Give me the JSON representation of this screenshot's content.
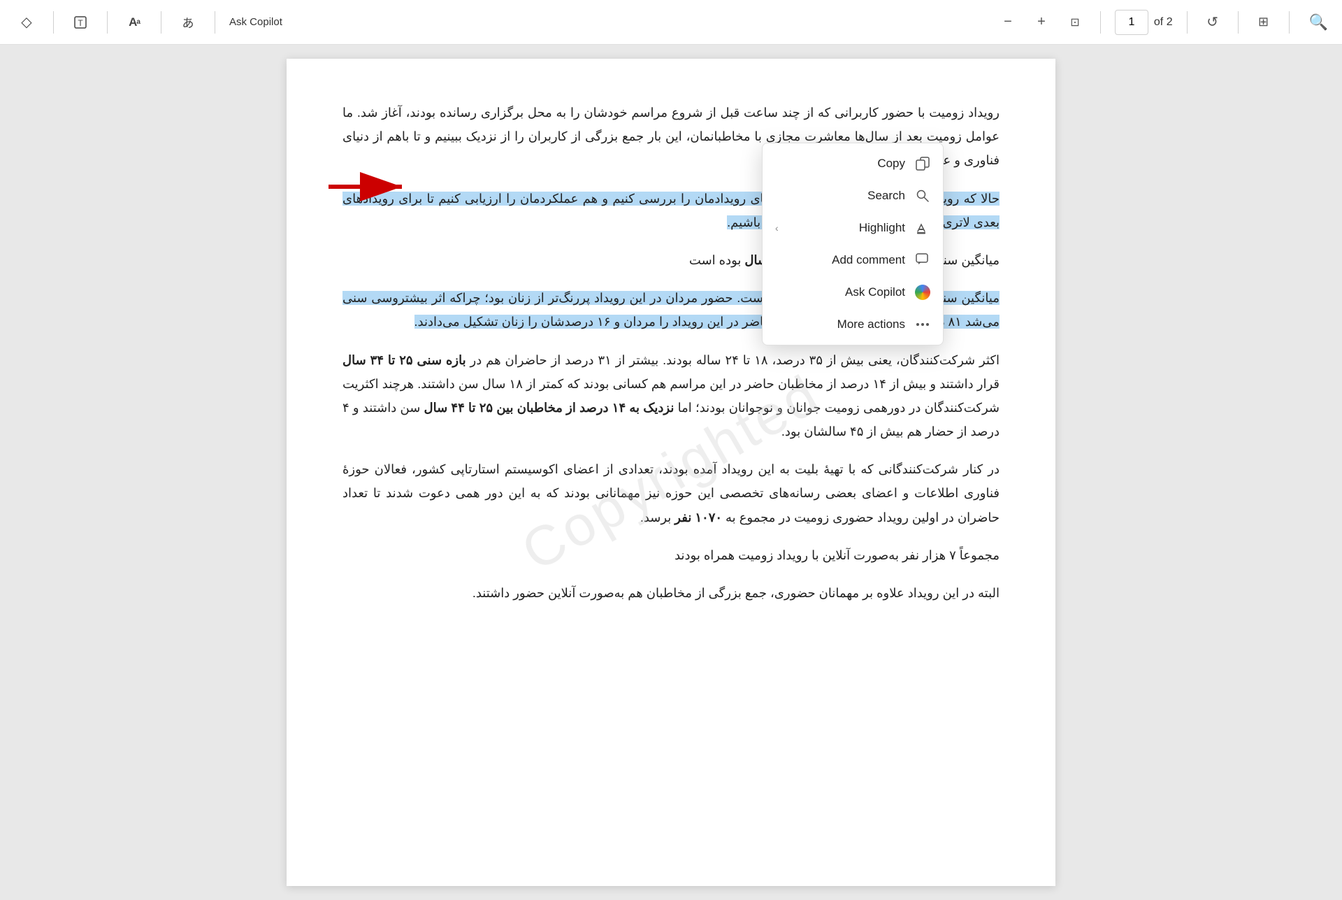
{
  "toolbar": {
    "tools": [
      {
        "id": "eraser",
        "icon": "◇",
        "label": "Eraser tool"
      },
      {
        "id": "text",
        "icon": "⊤",
        "label": "Text tool"
      },
      {
        "id": "font",
        "icon": "Aᵃ",
        "label": "Font"
      },
      {
        "id": "lang",
        "icon": "あ",
        "label": "Language"
      },
      {
        "id": "copilot",
        "icon": "Ask Copilot",
        "label": "Ask Copilot"
      }
    ],
    "zoom_minus": "−",
    "zoom_plus": "+",
    "zoom_fit": "⊡",
    "page_current": "1",
    "page_of": "of 2",
    "rotate": "↺",
    "layout": "⊞",
    "search_icon": "🔍"
  },
  "context_menu": {
    "items": [
      {
        "id": "copy",
        "icon": "copy",
        "label": "Copy",
        "arrow": false
      },
      {
        "id": "search",
        "icon": "search",
        "label": "Search",
        "arrow": false
      },
      {
        "id": "highlight",
        "icon": "highlight",
        "label": "Highlight",
        "arrow": true
      },
      {
        "id": "add-comment",
        "icon": "comment",
        "label": "Add comment",
        "arrow": false
      },
      {
        "id": "ask-copilot",
        "icon": "copilot",
        "label": "Ask Copilot",
        "arrow": false
      },
      {
        "id": "more-actions",
        "icon": "more",
        "label": "More actions",
        "arrow": false
      }
    ]
  },
  "document": {
    "paragraphs": [
      {
        "id": "p1",
        "text": "رویداد زومیت با حضور کاربرانی که از چند ساعت قبل از شروع مراسم خودشان را به محل برگزاری رسانده بودند، آغاز شد. ما عوامل زومیت بعد از سال‌ها معاشرت مجازی با مخاطبانمان، این بار جمع بزرگی از کاربران را از نزدیک ببینیم و تا باهم از دنیای فناوری و علایقمان بگوییم.",
        "highlighted": false
      },
      {
        "id": "p2",
        "text": "حالا که رویداد برگزار شده است که هم آمارهای رویدادمان را بررسی کنیم و هم عملکردمان را ارزیابی کنیم تا برای رویدادهای بعدی لاتری به دیدار شما بیاییم و میزبان بهتری باشیم.",
        "highlighted": true
      },
      {
        "id": "p3",
        "text": "میانگین سنی حاضران در رویداد زومیت ۲۶.۱ سال بوده است",
        "highlighted": false
      },
      {
        "id": "p4",
        "text": "میانگین سنی جمعیت زومیت ۲۶.۱ سال بوده است. حضور مردان در این رویداد پررنگ‌تر از زنان بود؛ چراکه اثر بیشتروسی سن می‌شد ۸۱ درصد از جمعیت بیش از هزار نفر حاضر در این رویداد را مردان و ۱۶ درصدشان را زنان تشکیل می‌دادند.",
        "highlighted": true
      },
      {
        "id": "p5",
        "text": "اکثر شرکت‌کنندگان، یعنی بیش از ۳۵ درصد، ۱۸ تا ۲۴ ساله بودند. بیشتر از ۳۱ درصد از حاضران هم در بازه سنی ۲۵ تا ۳۴ سال قرار داشتند و بیش از ۱۴ درصد از مخاطبان حاضر در این مراسم هم کسانی بودند که کمتر از ۱۸ سال سن داشتند. هرچند اکثریت شرکت‌کنندگان در دورهمی زومیت جوانان و نوجوانان بودند؛ اما نزدیک به ۱۴ درصد از مخاطبان بین ۲۵ تا ۴۴ سال سن داشتند و ۴ درصد از حضار هم بیش از ۴۵ سالشان بود.",
        "highlighted": false
      },
      {
        "id": "p6",
        "text": "در کنار شرکت‌کنندگانی که با تهیهٔ بلیت به این رویداد آمده بودند، تعدادی از اعضای اکوسیستم استارتاپی کشور، فعالان حوزهٔ فناوری اطلاعات و اعضای بعضی رسانه‌های تخصصی این حوزه نیز مهمانانی بودند که به این دور همی دعوت شدند تا تعداد حاضران در اولین رویداد حضوری زومیت در مجموع به ۱۰۷۰ نفر برسد.",
        "highlighted": false
      },
      {
        "id": "p7",
        "text": "مجموعاً ۷ هزار نفر به‌صورت آنلاین با رویداد زومیت همراه بودند",
        "highlighted": false
      },
      {
        "id": "p8",
        "text": "البته در این رویداد علاوه بر مهمانان حضوری، جمع بزرگی از مخاطبان هم به‌صورت آنلاین حضور داشتند.",
        "highlighted": false
      }
    ]
  }
}
